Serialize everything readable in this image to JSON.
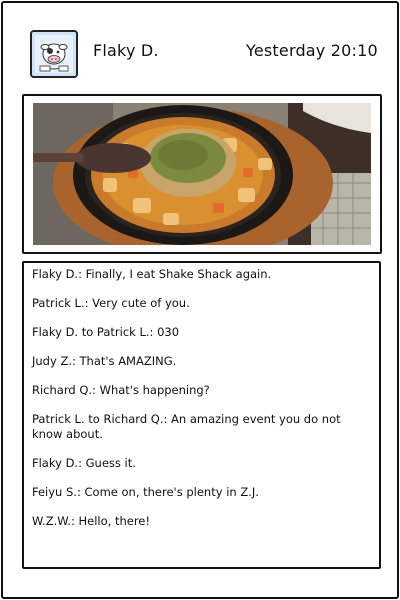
{
  "post": {
    "username": "Flaky D.",
    "timestamp": "Yesterday 20:10"
  },
  "icons": {
    "avatar": "cartoon-cow-avatar",
    "photo": "curry-dish-photo"
  },
  "comments": [
    {
      "author": "Flaky D.",
      "text": "Finally, I eat Shake Shack again."
    },
    {
      "author": "Patrick L.",
      "text": "Very cute of you."
    },
    {
      "author": "Flaky D. to Patrick L.",
      "text": "030"
    },
    {
      "author": "Judy Z.",
      "text": "That's AMAZING."
    },
    {
      "author": "Richard Q.",
      "text": "What's happening?"
    },
    {
      "author": "Patrick L. to Richard Q.",
      "text": "An amazing event you do not know about."
    },
    {
      "author": "Flaky D.",
      "text": "Guess it."
    },
    {
      "author": "Feiyu S.",
      "text": "Come on, there's plenty in Z.J."
    },
    {
      "author": "W.Z.W.",
      "text": "Hello, there!"
    }
  ]
}
